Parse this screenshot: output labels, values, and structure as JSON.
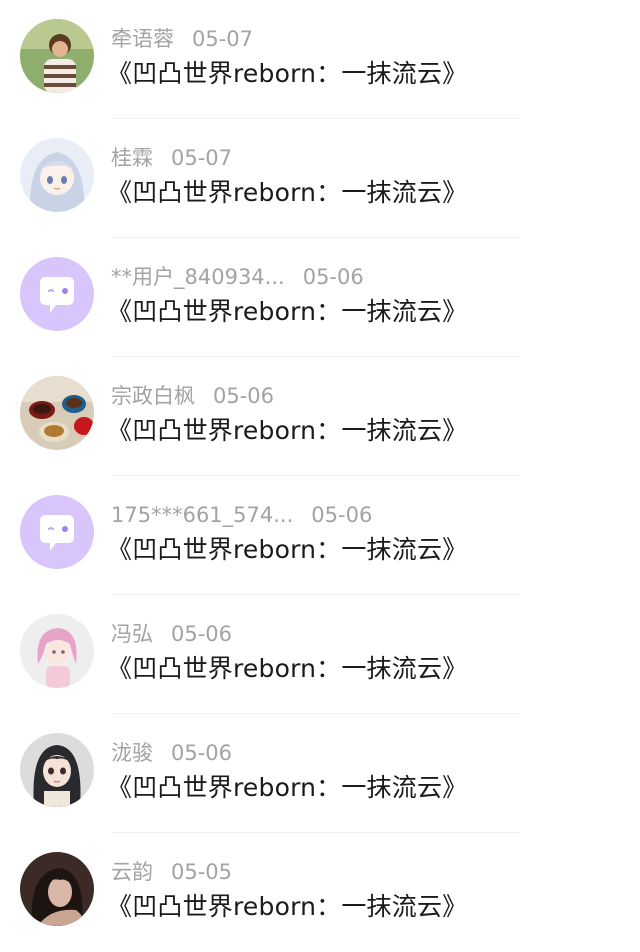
{
  "comments": [
    {
      "user": "牵语蓉",
      "date": "05-07",
      "title": "《凹凸世界reborn：一抹流云》",
      "avatar": "photo-boy-avatar"
    },
    {
      "user": "桂霖",
      "date": "05-07",
      "title": "《凹凸世界reborn：一抹流云》",
      "avatar": "anime-girl-avatar"
    },
    {
      "user": "**用户_840934...",
      "date": "05-06",
      "title": "《凹凸世界reborn：一抹流云》",
      "avatar": "default-chat-avatar"
    },
    {
      "user": "宗政白枫",
      "date": "05-06",
      "title": "《凹凸世界reborn：一抹流云》",
      "avatar": "teacups-avatar"
    },
    {
      "user": "175***661_574...",
      "date": "05-06",
      "title": "《凹凸世界reborn：一抹流云》",
      "avatar": "default-chat-avatar"
    },
    {
      "user": "冯弘",
      "date": "05-06",
      "title": "《凹凸世界reborn：一抹流云》",
      "avatar": "pink-hair-avatar"
    },
    {
      "user": "泷骏",
      "date": "05-06",
      "title": "《凹凸世界reborn：一抹流云》",
      "avatar": "dark-hair-girl-avatar"
    },
    {
      "user": "云韵",
      "date": "05-05",
      "title": "《凹凸世界reborn：一抹流云》",
      "avatar": "portrait-photo-avatar"
    }
  ],
  "colors": {
    "username": "#a3a3a3",
    "title": "#1b1b1b",
    "default_avatar_bg": "#d7c5fb",
    "divider": "#f0f0f0"
  }
}
